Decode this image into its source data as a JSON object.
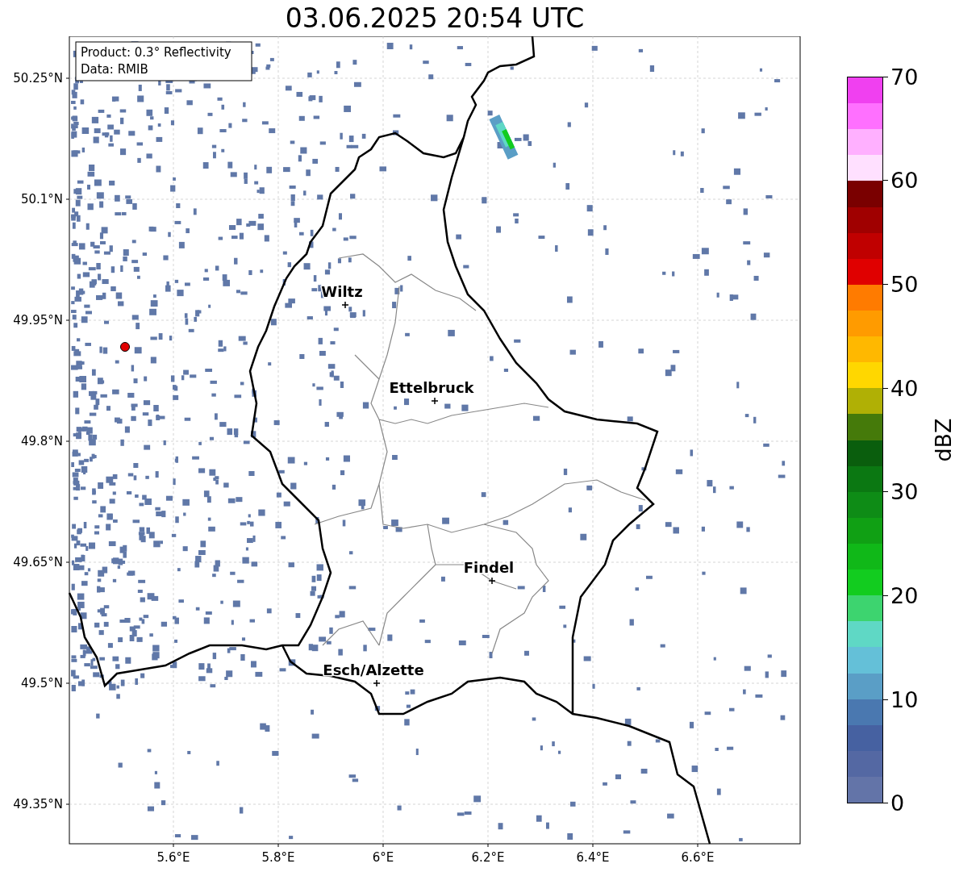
{
  "title": "03.06.2025 20:54 UTC",
  "info_box": [
    "Product: 0.3° Reflectivity",
    "Data: RMIB"
  ],
  "y_ticks": [
    "50.25°N",
    "50.1°N",
    "49.95°N",
    "49.8°N",
    "49.65°N",
    "49.5°N",
    "49.35°N"
  ],
  "x_ticks": [
    "5.6°E",
    "5.8°E",
    "6°E",
    "6.2°E",
    "6.4°E",
    "6.6°E"
  ],
  "cities": [
    {
      "name": "Wiltz"
    },
    {
      "name": "Ettelbruck"
    },
    {
      "name": "Findel"
    },
    {
      "name": "Esch/Alzette"
    }
  ],
  "colorbar": {
    "ticks": [
      "70",
      "60",
      "50",
      "40",
      "30",
      "20",
      "10",
      "0"
    ],
    "label": "dBZ",
    "segments": [
      {
        "color": "#f040f0"
      },
      {
        "color": "#ff70ff"
      },
      {
        "color": "#ffb0ff"
      },
      {
        "color": "#ffe0ff"
      },
      {
        "color": "#7a0000"
      },
      {
        "color": "#a00000"
      },
      {
        "color": "#c00000"
      },
      {
        "color": "#e00000"
      },
      {
        "color": "#ff7b00"
      },
      {
        "color": "#ff9b00"
      },
      {
        "color": "#ffb800"
      },
      {
        "color": "#ffd700"
      },
      {
        "color": "#b0b005"
      },
      {
        "color": "#457a0a"
      },
      {
        "color": "#0a5e0d"
      },
      {
        "color": "#0b7812"
      },
      {
        "color": "#0e8c16"
      },
      {
        "color": "#10a014"
      },
      {
        "color": "#10b818"
      },
      {
        "color": "#12cc1f"
      },
      {
        "color": "#3dd46f"
      },
      {
        "color": "#5fd8c5"
      },
      {
        "color": "#64c0d8"
      },
      {
        "color": "#5a9ec6"
      },
      {
        "color": "#4a78b0"
      },
      {
        "color": "#4661a1"
      },
      {
        "color": "#5468a3"
      },
      {
        "color": "#6374a8"
      }
    ]
  }
}
